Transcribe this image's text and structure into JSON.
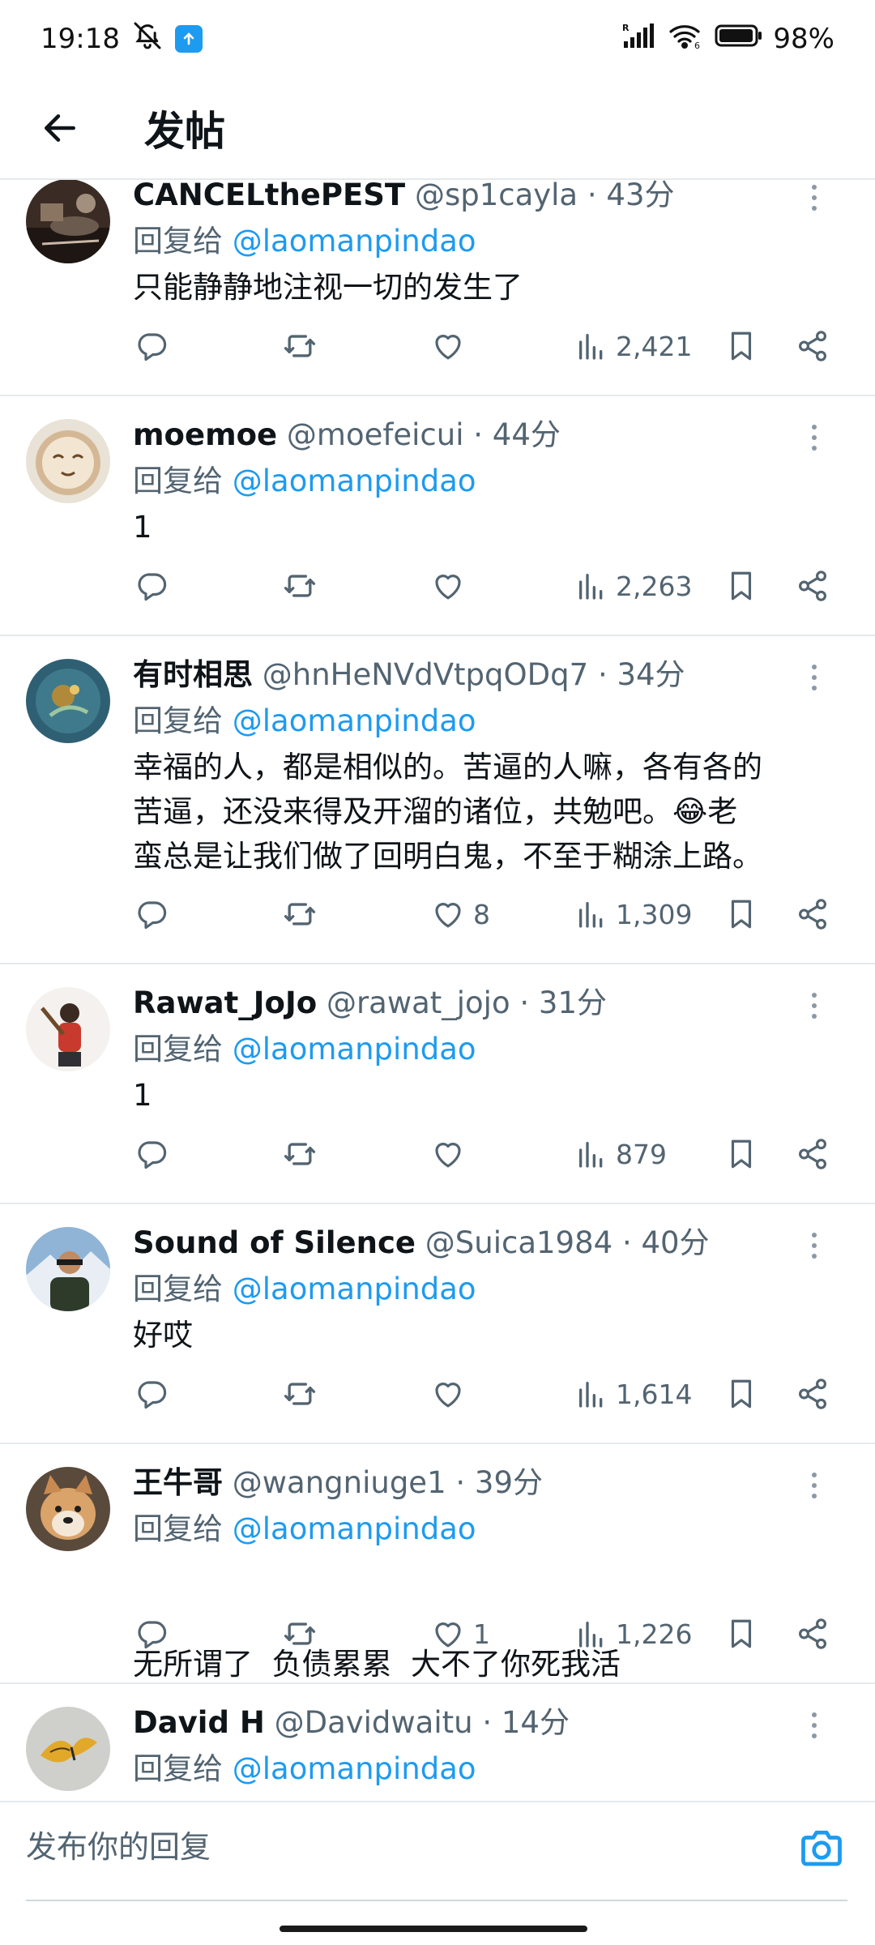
{
  "status_bar": {
    "time": "19:18",
    "battery_pct": "98%"
  },
  "header": {
    "title": "发帖"
  },
  "reply_prefix": "回复给",
  "replying_to": "@laomanpindao",
  "tweets": [
    {
      "name": "CANCELthePEST",
      "handle": "@sp1cayla",
      "time": "· 43分",
      "text_lines": [
        "只能静静地注视一切的发生了"
      ],
      "likes": "",
      "views": "2,421"
    },
    {
      "name": "moemoe",
      "handle": "@moefeicui",
      "time": "· 44分",
      "text_lines": [
        "1"
      ],
      "likes": "",
      "views": "2,263"
    },
    {
      "name": "有时相思",
      "handle": "@hnHeNVdVtpqODq7",
      "time": "· 34分",
      "text_lines": [
        "幸福的人，都是相似的。苦逼的人嘛，各有各的",
        "苦逼，还没来得及开溜的诸位，共勉吧。",
        "蛮总是让我们做了回明白鬼，不至于糊涂上路。"
      ],
      "emoji": "😂",
      "emoji_tail": "老",
      "likes": "8",
      "views": "1,309"
    },
    {
      "name": "Rawat_JoJo",
      "handle": "@rawat_jojo",
      "time": "· 31分",
      "text_lines": [
        "1"
      ],
      "likes": "",
      "views": "879"
    },
    {
      "name": "Sound of Silence",
      "handle": "@Suica1984",
      "time": "· 40分",
      "text_lines": [
        "好哎"
      ],
      "likes": "",
      "views": "1,614"
    },
    {
      "name": "王牛哥",
      "handle": "@wangniuge1",
      "time": "· 39分",
      "text_lines": [
        "无所谓了  负债累累  大不了你死我活"
      ],
      "likes": "1",
      "views": "1,226"
    },
    {
      "name": "David H",
      "handle": "@Davidwaitu",
      "time": "· 14分",
      "text_lines": [],
      "likes": "",
      "views": ""
    }
  ],
  "composer": {
    "placeholder": "发布你的回复"
  },
  "colors": {
    "accent": "#1d9bf0",
    "text": "#0f1419",
    "secondary": "#536471",
    "divider": "#e6e9ec"
  }
}
